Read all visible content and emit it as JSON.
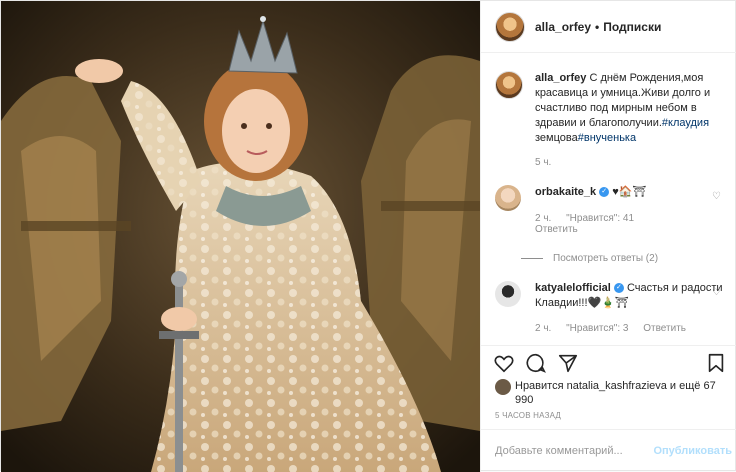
{
  "post": {
    "author": "alla_orfey",
    "separator": "•",
    "follow_label": "Подписки",
    "caption": {
      "username": "alla_orfey",
      "text": "С днём Рождения,моя красавица и умница.Живи долго и счастливо под мирным небом в здравии и благополучии.",
      "tag1": "#клаудия",
      "text2": "земцова",
      "tag2": "#внученька",
      "time": "5 ч."
    },
    "comments": [
      {
        "username": "orbakaite_k",
        "verified": true,
        "text": "♥🏠⛩",
        "time": "2 ч.",
        "likes": "\"Нравится\": 41",
        "reply": "Ответить",
        "view_replies": "Посмотреть ответы (2)"
      },
      {
        "username": "katyalelofficial",
        "verified": true,
        "text": "Счастья и радости Клавдии!!!🖤🎍⛩",
        "time": "2 ч.",
        "likes": "\"Нравится\": 3",
        "reply": "Ответить"
      }
    ],
    "likes_text": "Нравится natalia_kashfrazieva и ещё 67 990",
    "posted_ago": "5 ЧАСОВ НАЗАД",
    "add_comment_placeholder": "Добавьте комментарий...",
    "publish_label": "Опубликовать"
  },
  "icons": [
    "heart-icon",
    "comment-icon",
    "share-icon",
    "bookmark-icon",
    "small-heart-icon",
    "verified-icon"
  ],
  "colors": {
    "link": "#003569",
    "muted": "#8e8e8e",
    "publish_disabled": "#b2dffc",
    "verified": "#3897f0"
  }
}
